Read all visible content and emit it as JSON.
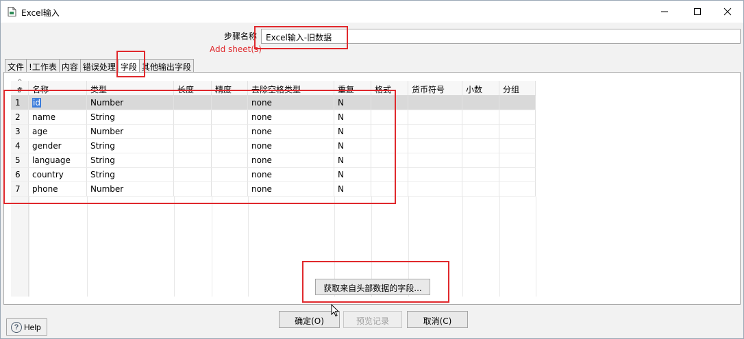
{
  "window": {
    "title": "Excel输入",
    "icon": "file-icon"
  },
  "form": {
    "step_label": "步骤名称",
    "step_value": "Excel输入-旧数据",
    "add_sheet_link": "Add sheet(s)"
  },
  "tabs": [
    {
      "label": "文件",
      "active": false
    },
    {
      "label": "!工作表",
      "active": false
    },
    {
      "label": "内容",
      "active": false
    },
    {
      "label": "错误处理",
      "active": false
    },
    {
      "label": "字段",
      "active": true
    },
    {
      "label": "其他输出字段",
      "active": false
    }
  ],
  "table": {
    "headers": [
      "#",
      "名称",
      "类型",
      "长度",
      "精度",
      "去除空格类型",
      "重复",
      "格式",
      "货币符号",
      "小数",
      "分组"
    ],
    "rows": [
      {
        "num": "1",
        "name": "id",
        "type": "Number",
        "length": "",
        "precision": "",
        "trim": "none",
        "repeat": "N",
        "format": "",
        "currency": "",
        "decimal": "",
        "group": ""
      },
      {
        "num": "2",
        "name": "name",
        "type": "String",
        "length": "",
        "precision": "",
        "trim": "none",
        "repeat": "N",
        "format": "",
        "currency": "",
        "decimal": "",
        "group": ""
      },
      {
        "num": "3",
        "name": "age",
        "type": "Number",
        "length": "",
        "precision": "",
        "trim": "none",
        "repeat": "N",
        "format": "",
        "currency": "",
        "decimal": "",
        "group": ""
      },
      {
        "num": "4",
        "name": "gender",
        "type": "String",
        "length": "",
        "precision": "",
        "trim": "none",
        "repeat": "N",
        "format": "",
        "currency": "",
        "decimal": "",
        "group": ""
      },
      {
        "num": "5",
        "name": "language",
        "type": "String",
        "length": "",
        "precision": "",
        "trim": "none",
        "repeat": "N",
        "format": "",
        "currency": "",
        "decimal": "",
        "group": ""
      },
      {
        "num": "6",
        "name": "country",
        "type": "String",
        "length": "",
        "precision": "",
        "trim": "none",
        "repeat": "N",
        "format": "",
        "currency": "",
        "decimal": "",
        "group": ""
      },
      {
        "num": "7",
        "name": "phone",
        "type": "Number",
        "length": "",
        "precision": "",
        "trim": "none",
        "repeat": "N",
        "format": "",
        "currency": "",
        "decimal": "",
        "group": ""
      }
    ]
  },
  "buttons": {
    "get_fields": "获取来自头部数据的字段...",
    "help": "Help",
    "ok": "确定(O)",
    "preview": "预览记录",
    "cancel": "取消(C)"
  },
  "colors": {
    "annotation_red": "#e0282c",
    "selection_blue": "#3c7ddb",
    "selected_row": "#d9d9d9"
  }
}
